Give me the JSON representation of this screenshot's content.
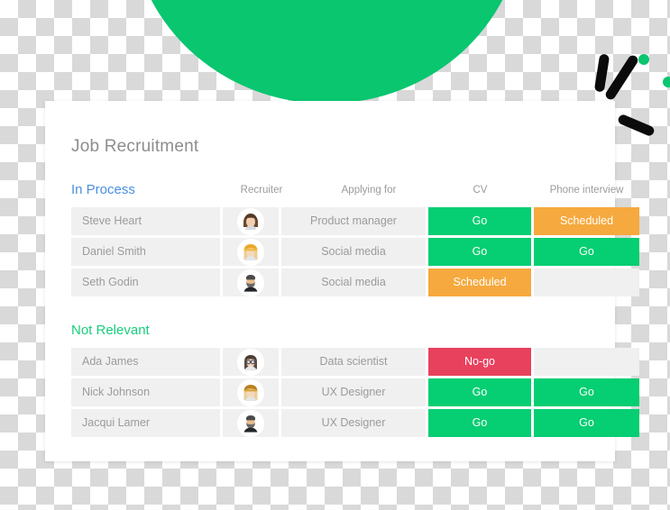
{
  "decor": {
    "arc_color": "#09C66F",
    "stroke_color": "#0b0b0b",
    "dot_color": "#09C66F"
  },
  "card": {
    "title": "Job Recruitment"
  },
  "columns": {
    "recruiter": "Recruiter",
    "applying_for": "Applying for",
    "cv": "CV",
    "phone_interview": "Phone interview"
  },
  "status_colors": {
    "go": "#06CE72",
    "scheduled": "#F6A93E",
    "nogo": "#E8415E",
    "empty": "#f0f0f0"
  },
  "sections": [
    {
      "label": "In Process",
      "label_color": "#4A90E2",
      "rows": [
        {
          "name": "Steve Heart",
          "avatar": "avatar-woman-brown-hair",
          "applying_for": "Product manager",
          "cv": "Go",
          "cv_state": "go",
          "phone_interview": "Scheduled",
          "phone_state": "scheduled"
        },
        {
          "name": "Daniel Smith",
          "avatar": "avatar-woman-blonde-beanie",
          "applying_for": "Social media",
          "cv": "Go",
          "cv_state": "go",
          "phone_interview": "Go",
          "phone_state": "go"
        },
        {
          "name": "Seth Godin",
          "avatar": "avatar-man-beard",
          "applying_for": "Social media",
          "cv": "Scheduled",
          "cv_state": "scheduled",
          "phone_interview": "",
          "phone_state": "empty"
        }
      ]
    },
    {
      "label": "Not Relevant",
      "label_color": "#19CE7B",
      "rows": [
        {
          "name": "Ada James",
          "avatar": "avatar-woman-glasses",
          "applying_for": "Data scientist",
          "cv": "No-go",
          "cv_state": "nogo",
          "phone_interview": "",
          "phone_state": "empty"
        },
        {
          "name": "Nick Johnson",
          "avatar": "avatar-woman-blonde-beanie",
          "applying_for": "UX Designer",
          "cv": "Go",
          "cv_state": "go",
          "phone_interview": "Go",
          "phone_state": "go"
        },
        {
          "name": "Jacqui Lamer",
          "avatar": "avatar-man-beard",
          "applying_for": "UX Designer",
          "cv": "Go",
          "cv_state": "go",
          "phone_interview": "Go",
          "phone_state": "go"
        }
      ]
    }
  ]
}
